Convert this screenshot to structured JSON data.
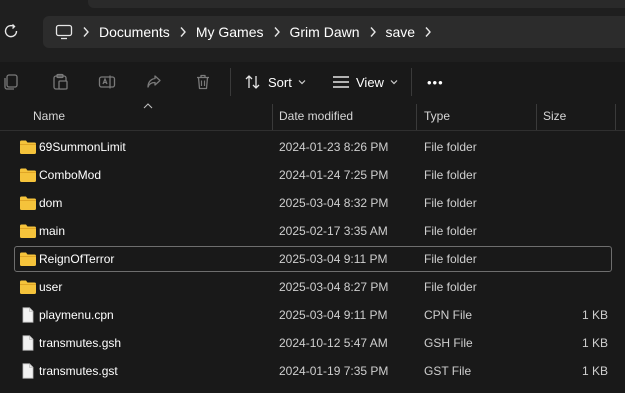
{
  "breadcrumb": {
    "items": [
      "Documents",
      "My Games",
      "Grim Dawn",
      "save"
    ]
  },
  "icons": {
    "refresh": "refresh-icon",
    "this_pc": "monitor-icon",
    "copy": "copy-icon",
    "paste": "paste-icon",
    "rename": "rename-icon",
    "share": "share-icon",
    "delete": "trash-icon",
    "sort": "sort-icon",
    "view": "view-icon",
    "more": "more-icon",
    "folder": "folder-icon",
    "file": "file-icon"
  },
  "toolbar": {
    "sort_label": "Sort",
    "view_label": "View",
    "more_label": "•••"
  },
  "columns": {
    "name": "Name",
    "date": "Date modified",
    "type": "Type",
    "size": "Size"
  },
  "files": [
    {
      "name": "69SummonLimit",
      "date": "2024-01-23 8:26 PM",
      "type": "File folder",
      "size": "",
      "kind": "folder"
    },
    {
      "name": "ComboMod",
      "date": "2024-01-24 7:25 PM",
      "type": "File folder",
      "size": "",
      "kind": "folder"
    },
    {
      "name": "dom",
      "date": "2025-03-04 8:32 PM",
      "type": "File folder",
      "size": "",
      "kind": "folder"
    },
    {
      "name": "main",
      "date": "2025-02-17 3:35 AM",
      "type": "File folder",
      "size": "",
      "kind": "folder"
    },
    {
      "name": "ReignOfTerror",
      "date": "2025-03-04 9:11 PM",
      "type": "File folder",
      "size": "",
      "kind": "folder",
      "focused": true
    },
    {
      "name": "user",
      "date": "2025-03-04 8:27 PM",
      "type": "File folder",
      "size": "",
      "kind": "folder"
    },
    {
      "name": "playmenu.cpn",
      "date": "2025-03-04 9:11 PM",
      "type": "CPN File",
      "size": "1 KB",
      "kind": "file"
    },
    {
      "name": "transmutes.gsh",
      "date": "2024-10-12 5:47 AM",
      "type": "GSH File",
      "size": "1 KB",
      "kind": "file"
    },
    {
      "name": "transmutes.gst",
      "date": "2024-01-19 7:35 PM",
      "type": "GST File",
      "size": "1 KB",
      "kind": "file"
    }
  ],
  "colors": {
    "background": "#191919",
    "address_bar": "#2c2c2c",
    "folder_yellow": "#f5c33b",
    "text_primary": "#ffffff",
    "text_secondary": "#cfcfcf"
  }
}
